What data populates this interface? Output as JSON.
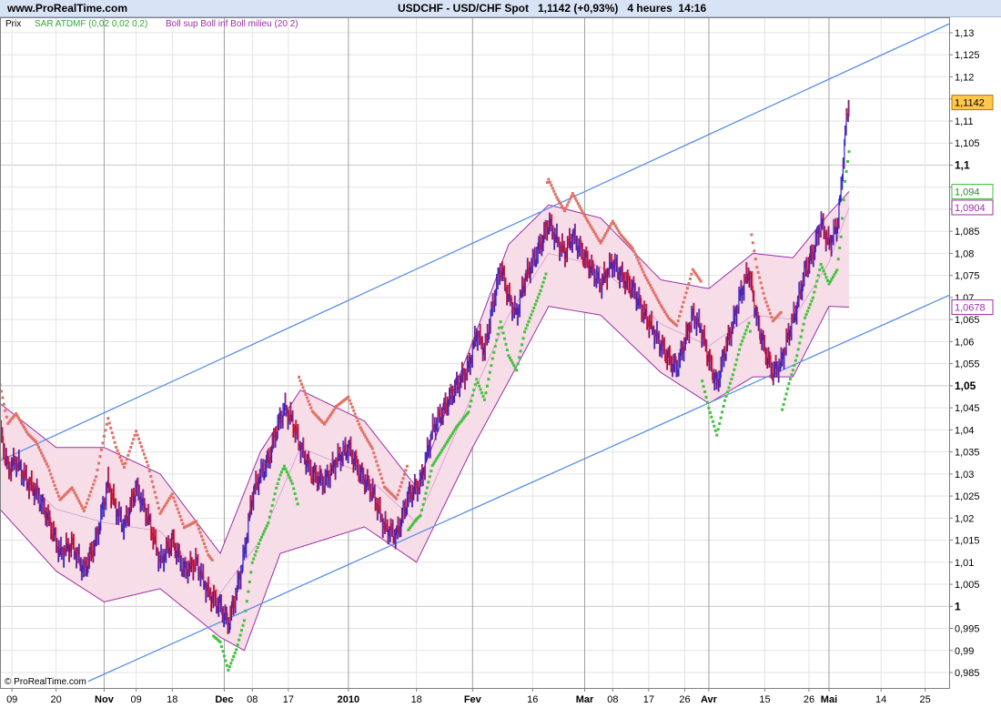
{
  "header": {
    "site": "www.ProRealTime.com",
    "title": "USDCHF - USD/CHF Spot   1,1142 (+0,93%)   4 heures  14:16"
  },
  "legend": {
    "prix": "Prix",
    "sar": "SAR ATDMF (0,02 0,02 0,2)",
    "boll": "Boll sup Boll inf Boll milieu (20 2)"
  },
  "watermark": "© ProRealTime.com",
  "colors": {
    "background": "#ffffff",
    "header_bg": "#d8e4f5",
    "grid": "#e3e3e3",
    "month_line": "#a0a0a0",
    "up_candle": "#2424d6",
    "down_candle": "#e0202a",
    "sar_below": "#42c23c",
    "sar_above": "#e07066",
    "band_fill": "#f7dde8",
    "band_line": "#9b2fa6",
    "channel": "#5a8fe6",
    "price_badge": "#ffc84a"
  },
  "chart_data": {
    "type": "line",
    "title": "USDCHF - USD/CHF Spot",
    "interval": "4 heures",
    "last_price": "1,1142",
    "change": "+0,93%",
    "ylim": [
      0.9815,
      1.1335
    ],
    "yticks": [
      "0,985",
      "0,99",
      "0,995",
      "1",
      "1,005",
      "1,01",
      "1,015",
      "1,02",
      "1,025",
      "1,03",
      "1,035",
      "1,04",
      "1,045",
      "1,05",
      "1,055",
      "1,06",
      "1,065",
      "1,07",
      "1,075",
      "1,08",
      "1,085",
      "1,09",
      "1,095",
      "1,1",
      "1,105",
      "1,11",
      "1,115",
      "1,12",
      "1,125",
      "1,13"
    ],
    "yticks_major": [
      "1",
      "1,05",
      "1,1"
    ],
    "xlim": [
      "2009-10-06",
      "2010-05-31"
    ],
    "xticks": [
      {
        "label": "09",
        "date": "2009-10-09"
      },
      {
        "label": "20",
        "date": "2009-10-20"
      },
      {
        "label": "Nov",
        "date": "2009-11-01",
        "major": true
      },
      {
        "label": "09",
        "date": "2009-11-09"
      },
      {
        "label": "18",
        "date": "2009-11-18"
      },
      {
        "label": "Dec",
        "date": "2009-12-01",
        "major": true
      },
      {
        "label": "08",
        "date": "2009-12-08"
      },
      {
        "label": "17",
        "date": "2009-12-17"
      },
      {
        "label": "2010",
        "date": "2010-01-01",
        "major": true
      },
      {
        "label": "18",
        "date": "2010-01-18"
      },
      {
        "label": "Fev",
        "date": "2010-02-01",
        "major": true
      },
      {
        "label": "16",
        "date": "2010-02-16"
      },
      {
        "label": "Mar",
        "date": "2010-03-01",
        "major": true
      },
      {
        "label": "08",
        "date": "2010-03-08"
      },
      {
        "label": "17",
        "date": "2010-03-17"
      },
      {
        "label": "26",
        "date": "2010-03-26"
      },
      {
        "label": "Avr",
        "date": "2010-04-01",
        "major": true
      },
      {
        "label": "15",
        "date": "2010-04-15"
      },
      {
        "label": "26",
        "date": "2010-04-26"
      },
      {
        "label": "Mai",
        "date": "2010-05-01",
        "major": true
      },
      {
        "label": "14",
        "date": "2010-05-14"
      },
      {
        "label": "25",
        "date": "2010-05-25"
      }
    ],
    "series": [
      {
        "name": "Prix",
        "points": [
          [
            "2009-10-06",
            1.04
          ],
          [
            "2009-10-08",
            1.031
          ],
          [
            "2009-10-10",
            1.033
          ],
          [
            "2009-10-13",
            1.028
          ],
          [
            "2009-10-15",
            1.026
          ],
          [
            "2009-10-18",
            1.02
          ],
          [
            "2009-10-21",
            1.012
          ],
          [
            "2009-10-24",
            1.014
          ],
          [
            "2009-10-27",
            1.008
          ],
          [
            "2009-10-30",
            1.015
          ],
          [
            "2009-11-02",
            1.028
          ],
          [
            "2009-11-04",
            1.022
          ],
          [
            "2009-11-06",
            1.018
          ],
          [
            "2009-11-09",
            1.027
          ],
          [
            "2009-11-12",
            1.02
          ],
          [
            "2009-11-15",
            1.01
          ],
          [
            "2009-11-18",
            1.015
          ],
          [
            "2009-11-21",
            1.008
          ],
          [
            "2009-11-24",
            1.01
          ],
          [
            "2009-11-27",
            1.003
          ],
          [
            "2009-11-30",
            1.0
          ],
          [
            "2009-12-02",
            0.996
          ],
          [
            "2009-12-04",
            1.003
          ],
          [
            "2009-12-06",
            1.012
          ],
          [
            "2009-12-08",
            1.025
          ],
          [
            "2009-12-10",
            1.03
          ],
          [
            "2009-12-12",
            1.033
          ],
          [
            "2009-12-14",
            1.04
          ],
          [
            "2009-12-16",
            1.045
          ],
          [
            "2009-12-18",
            1.042
          ],
          [
            "2009-12-20",
            1.036
          ],
          [
            "2009-12-23",
            1.03
          ],
          [
            "2009-12-26",
            1.028
          ],
          [
            "2009-12-29",
            1.033
          ],
          [
            "2010-01-01",
            1.036
          ],
          [
            "2010-01-04",
            1.03
          ],
          [
            "2010-01-07",
            1.026
          ],
          [
            "2010-01-10",
            1.018
          ],
          [
            "2010-01-13",
            1.016
          ],
          [
            "2010-01-16",
            1.025
          ],
          [
            "2010-01-19",
            1.028
          ],
          [
            "2010-01-22",
            1.04
          ],
          [
            "2010-01-25",
            1.045
          ],
          [
            "2010-01-28",
            1.05
          ],
          [
            "2010-01-31",
            1.054
          ],
          [
            "2010-02-02",
            1.062
          ],
          [
            "2010-02-04",
            1.058
          ],
          [
            "2010-02-06",
            1.068
          ],
          [
            "2010-02-08",
            1.077
          ],
          [
            "2010-02-10",
            1.07
          ],
          [
            "2010-02-12",
            1.066
          ],
          [
            "2010-02-14",
            1.074
          ],
          [
            "2010-02-16",
            1.078
          ],
          [
            "2010-02-18",
            1.082
          ],
          [
            "2010-02-20",
            1.087
          ],
          [
            "2010-02-22",
            1.083
          ],
          [
            "2010-02-24",
            1.08
          ],
          [
            "2010-02-26",
            1.084
          ],
          [
            "2010-03-01",
            1.079
          ],
          [
            "2010-03-03",
            1.076
          ],
          [
            "2010-03-05",
            1.073
          ],
          [
            "2010-03-08",
            1.078
          ],
          [
            "2010-03-10",
            1.075
          ],
          [
            "2010-03-13",
            1.072
          ],
          [
            "2010-03-16",
            1.066
          ],
          [
            "2010-03-19",
            1.061
          ],
          [
            "2010-03-22",
            1.056
          ],
          [
            "2010-03-24",
            1.054
          ],
          [
            "2010-03-26",
            1.06
          ],
          [
            "2010-03-28",
            1.066
          ],
          [
            "2010-03-30",
            1.063
          ],
          [
            "2010-04-01",
            1.056
          ],
          [
            "2010-04-03",
            1.05
          ],
          [
            "2010-04-05",
            1.058
          ],
          [
            "2010-04-07",
            1.064
          ],
          [
            "2010-04-09",
            1.071
          ],
          [
            "2010-04-11",
            1.076
          ],
          [
            "2010-04-13",
            1.065
          ],
          [
            "2010-04-15",
            1.058
          ],
          [
            "2010-04-17",
            1.053
          ],
          [
            "2010-04-19",
            1.055
          ],
          [
            "2010-04-21",
            1.062
          ],
          [
            "2010-04-23",
            1.068
          ],
          [
            "2010-04-25",
            1.076
          ],
          [
            "2010-04-27",
            1.08
          ],
          [
            "2010-04-29",
            1.087
          ],
          [
            "2010-05-01",
            1.082
          ],
          [
            "2010-05-03",
            1.086
          ],
          [
            "2010-05-04",
            1.094
          ],
          [
            "2010-05-05",
            1.107
          ],
          [
            "2010-05-06",
            1.1142
          ]
        ]
      },
      {
        "name": "Boll sup",
        "points": [
          [
            "2009-10-06",
            1.046
          ],
          [
            "2009-10-20",
            1.036
          ],
          [
            "2009-11-01",
            1.036
          ],
          [
            "2009-11-15",
            1.03
          ],
          [
            "2009-11-30",
            1.012
          ],
          [
            "2009-12-10",
            1.035
          ],
          [
            "2009-12-20",
            1.049
          ],
          [
            "2010-01-05",
            1.042
          ],
          [
            "2010-01-18",
            1.027
          ],
          [
            "2010-02-01",
            1.06
          ],
          [
            "2010-02-10",
            1.082
          ],
          [
            "2010-02-20",
            1.091
          ],
          [
            "2010-03-05",
            1.088
          ],
          [
            "2010-03-20",
            1.074
          ],
          [
            "2010-04-01",
            1.072
          ],
          [
            "2010-04-12",
            1.08
          ],
          [
            "2010-04-22",
            1.079
          ],
          [
            "2010-05-01",
            1.089
          ],
          [
            "2010-05-06",
            1.094
          ]
        ]
      },
      {
        "name": "Boll inf",
        "points": [
          [
            "2009-10-06",
            1.022
          ],
          [
            "2009-10-20",
            1.008
          ],
          [
            "2009-11-01",
            1.001
          ],
          [
            "2009-11-15",
            1.004
          ],
          [
            "2009-11-30",
            0.993
          ],
          [
            "2009-12-06",
            0.99
          ],
          [
            "2009-12-15",
            1.012
          ],
          [
            "2010-01-05",
            1.018
          ],
          [
            "2010-01-18",
            1.01
          ],
          [
            "2010-02-01",
            1.036
          ],
          [
            "2010-02-10",
            1.051
          ],
          [
            "2010-02-20",
            1.068
          ],
          [
            "2010-03-05",
            1.066
          ],
          [
            "2010-03-20",
            1.053
          ],
          [
            "2010-04-01",
            1.046
          ],
          [
            "2010-04-12",
            1.052
          ],
          [
            "2010-04-22",
            1.052
          ],
          [
            "2010-05-01",
            1.068
          ],
          [
            "2010-05-06",
            1.0678
          ]
        ]
      },
      {
        "name": "Boll milieu",
        "points": [
          [
            "2009-10-06",
            1.034
          ],
          [
            "2009-10-20",
            1.022
          ],
          [
            "2009-11-01",
            1.019
          ],
          [
            "2009-11-15",
            1.017
          ],
          [
            "2009-11-30",
            1.003
          ],
          [
            "2009-12-10",
            1.015
          ],
          [
            "2009-12-20",
            1.036
          ],
          [
            "2010-01-05",
            1.03
          ],
          [
            "2010-01-18",
            1.019
          ],
          [
            "2010-02-01",
            1.048
          ],
          [
            "2010-02-10",
            1.066
          ],
          [
            "2010-02-20",
            1.08
          ],
          [
            "2010-03-05",
            1.077
          ],
          [
            "2010-03-20",
            1.064
          ],
          [
            "2010-04-01",
            1.059
          ],
          [
            "2010-04-12",
            1.066
          ],
          [
            "2010-04-22",
            1.065
          ],
          [
            "2010-05-01",
            1.078
          ],
          [
            "2010-05-06",
            1.0904
          ]
        ]
      }
    ],
    "channel_lines": [
      {
        "from": [
          "2009-10-06",
          1.033
        ],
        "to": [
          "2010-05-31",
          1.132
        ]
      },
      {
        "from": [
          "2009-10-28",
          0.983
        ],
        "to": [
          "2010-05-31",
          1.0705
        ]
      }
    ],
    "price_labels": [
      {
        "label": "1,1142",
        "value": 1.1142,
        "kind": "last"
      },
      {
        "label": "1,094",
        "value": 1.094,
        "kind": "sar"
      },
      {
        "label": "1,0904",
        "value": 1.0904,
        "kind": "boll"
      },
      {
        "label": "1,0678",
        "value": 1.0678,
        "kind": "boll"
      }
    ]
  }
}
